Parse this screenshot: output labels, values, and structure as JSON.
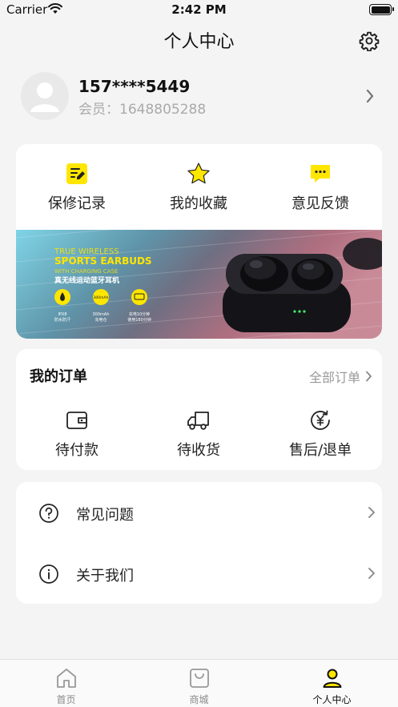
{
  "status_bar": {
    "carrier": "Carrier",
    "time": "2:42 PM"
  },
  "header": {
    "title": "个人中心",
    "settings_icon": "gear-icon"
  },
  "profile": {
    "phone": "157****5449",
    "member_prefix": "会员：",
    "member_id": "1648805288"
  },
  "quick_actions": [
    {
      "label": "保修记录",
      "icon": "document-edit-icon"
    },
    {
      "label": "我的收藏",
      "icon": "star-icon"
    },
    {
      "label": "意见反馈",
      "icon": "chat-bubble-icon"
    }
  ],
  "banner": {
    "line1": "TRUE WIRELESS",
    "line2": "SPORTS EARBUDS",
    "line3": "WITH CHARGING CASE",
    "line4": "真无线运动蓝牙耳机",
    "badges": [
      {
        "icon_text": "",
        "caption1": "IPX8",
        "caption2": "防水防汗"
      },
      {
        "icon_text": "300mAh",
        "caption1": "300mAh",
        "caption2": "充电仓"
      },
      {
        "icon_text": "",
        "caption1": "充电10分钟",
        "caption2": "使用180分钟"
      }
    ]
  },
  "orders": {
    "title": "我的订单",
    "all_label": "全部订单",
    "items": [
      {
        "label": "待付款",
        "icon": "wallet-icon"
      },
      {
        "label": "待收货",
        "icon": "delivery-truck-icon"
      },
      {
        "label": "售后/退单",
        "icon": "yen-refund-icon"
      }
    ]
  },
  "list": [
    {
      "label": "常见问题",
      "icon": "question-circle-icon"
    },
    {
      "label": "关于我们",
      "icon": "info-circle-icon"
    }
  ],
  "tabs": [
    {
      "label": "首页",
      "icon": "home-icon",
      "active": false
    },
    {
      "label": "商城",
      "icon": "shopping-bag-icon",
      "active": false
    },
    {
      "label": "个人中心",
      "icon": "user-icon",
      "active": true
    }
  ],
  "colors": {
    "accent": "#FFE600",
    "background": "#F4F4F4",
    "card": "#FFFFFF",
    "muted": "#999999"
  }
}
